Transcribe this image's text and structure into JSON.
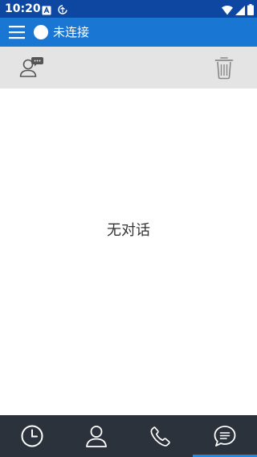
{
  "status_bar": {
    "time": "10:20",
    "left_icons": [
      "a-box-icon",
      "sync-icon"
    ],
    "right_icons": [
      "wifi-icon",
      "signal-icon",
      "battery-icon"
    ]
  },
  "app_bar": {
    "connection_status": "未连接",
    "status_color": "#ffffff",
    "background_color": "#1976d2"
  },
  "toolbar": {
    "left_icon": "contact-chat-icon",
    "right_icon": "trash-icon"
  },
  "content": {
    "empty_message": "无对话"
  },
  "bottom_nav": {
    "tabs": [
      {
        "icon": "clock-icon",
        "selected": false
      },
      {
        "icon": "person-icon",
        "selected": false
      },
      {
        "icon": "phone-icon",
        "selected": false
      },
      {
        "icon": "chat-icon",
        "selected": true
      }
    ],
    "indicator_color": "#1e88e5"
  }
}
